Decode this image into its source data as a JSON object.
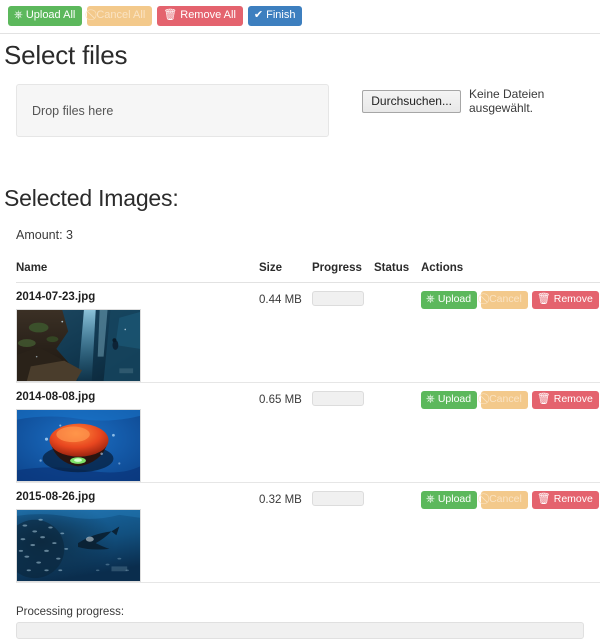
{
  "toolbar": {
    "buttons": [
      {
        "label": "Upload All",
        "icon": "upload-circle-icon",
        "style": "success",
        "disabled": false
      },
      {
        "label": "Cancel All",
        "icon": "ban-icon",
        "style": "warning",
        "disabled": true
      },
      {
        "label": "Remove All",
        "icon": "trash-icon",
        "style": "danger",
        "disabled": false
      },
      {
        "label": "Finish",
        "icon": "check-icon",
        "style": "primary",
        "disabled": false
      }
    ]
  },
  "select_files": {
    "title": "Select files",
    "dropzone_text": "Drop files here",
    "browse_button": "Durchsuchen...",
    "file_status": "Keine Dateien ausgewählt."
  },
  "selected_images": {
    "title": "Selected Images:",
    "amount_label": "Amount: 3",
    "columns": [
      "Name",
      "Size",
      "Progress",
      "Status",
      "Actions"
    ],
    "row_actions": [
      {
        "label": "Upload",
        "icon": "upload-circle-icon",
        "style": "success",
        "disabled": false
      },
      {
        "label": "Cancel",
        "icon": "ban-icon",
        "style": "warning",
        "disabled": true
      },
      {
        "label": "Remove",
        "icon": "trash-icon",
        "style": "danger",
        "disabled": false
      }
    ],
    "rows": [
      {
        "name": "2014-07-23.jpg",
        "size": "0.44 MB",
        "progress": "",
        "status": "",
        "thumbnail": "underwater-cave-diver"
      },
      {
        "name": "2014-08-08.jpg",
        "size": "0.65 MB",
        "progress": "",
        "status": "",
        "thumbnail": "orange-jellyfish"
      },
      {
        "name": "2015-08-26.jpg",
        "size": "0.32 MB",
        "progress": "",
        "status": "",
        "thumbnail": "fish-school-diver"
      }
    ]
  },
  "processing": {
    "label": "Processing progress:",
    "value": ""
  },
  "colors": {
    "success": "#5cb85c",
    "warning": "#f3c98b",
    "danger": "#e4636e",
    "primary": "#3d7fbf",
    "text": "#333333",
    "rule": "#e2e2e2"
  }
}
